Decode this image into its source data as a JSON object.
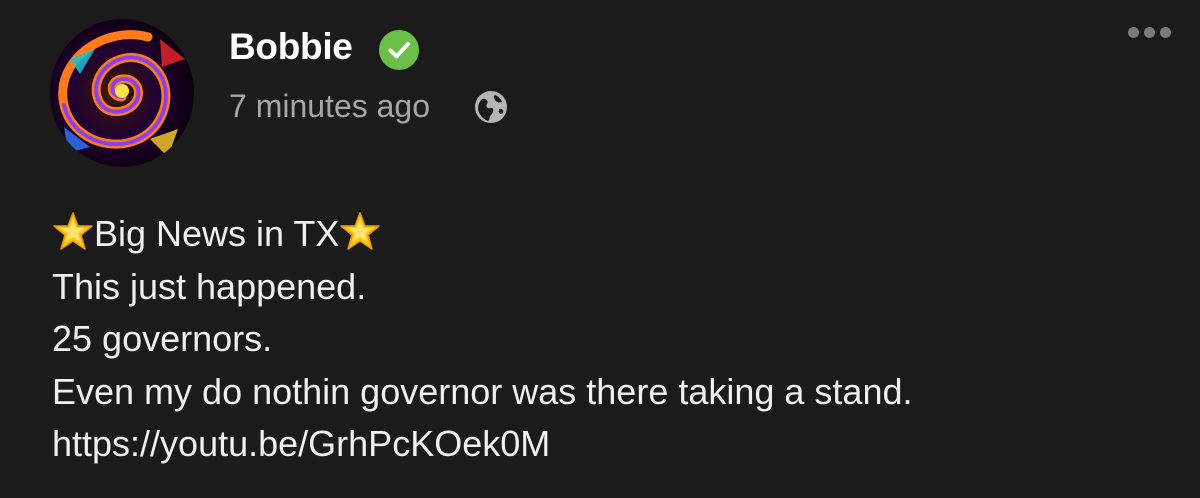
{
  "post": {
    "author": {
      "name": "Bobbie",
      "verified": true,
      "avatar_icon": "fractal-spiral-avatar"
    },
    "meta": {
      "timestamp": "7 minutes ago",
      "visibility_icon": "globe-icon"
    },
    "menu_icon": "more-options-icon",
    "body": {
      "headline": "Big News in TX",
      "headline_emoji": "glowing-star",
      "lines": [
        "This just happened.",
        "25 governors.",
        "Even my do nothin governor was there taking a stand."
      ],
      "link": "https://youtu.be/GrhPcKOek0M"
    }
  },
  "colors": {
    "background": "#1b1b1b",
    "name": "#ffffff",
    "timestamp": "#a6a6a6",
    "verified_badge": "#6cc04a",
    "body_text": "#f0f0f0"
  }
}
